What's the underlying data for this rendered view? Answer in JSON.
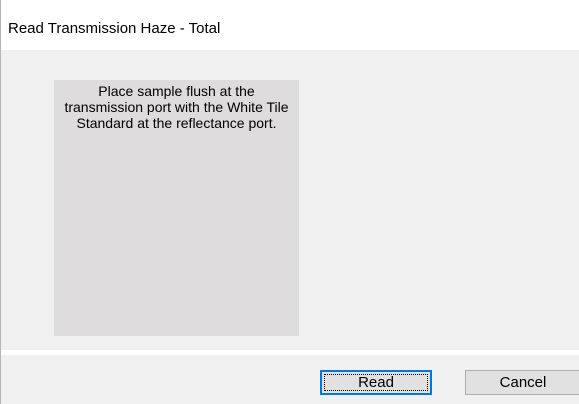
{
  "window": {
    "title": "Read Transmission Haze - Total"
  },
  "instruction": {
    "text": "Place sample flush at the transmission port with the White Tile Standard at the reflectance port."
  },
  "buttons": {
    "read_label": "Read",
    "cancel_label": "Cancel"
  },
  "colors": {
    "panel_background": "#dedcdc",
    "dialog_background": "#f0f0f0",
    "default_button_border": "#0078d7"
  }
}
